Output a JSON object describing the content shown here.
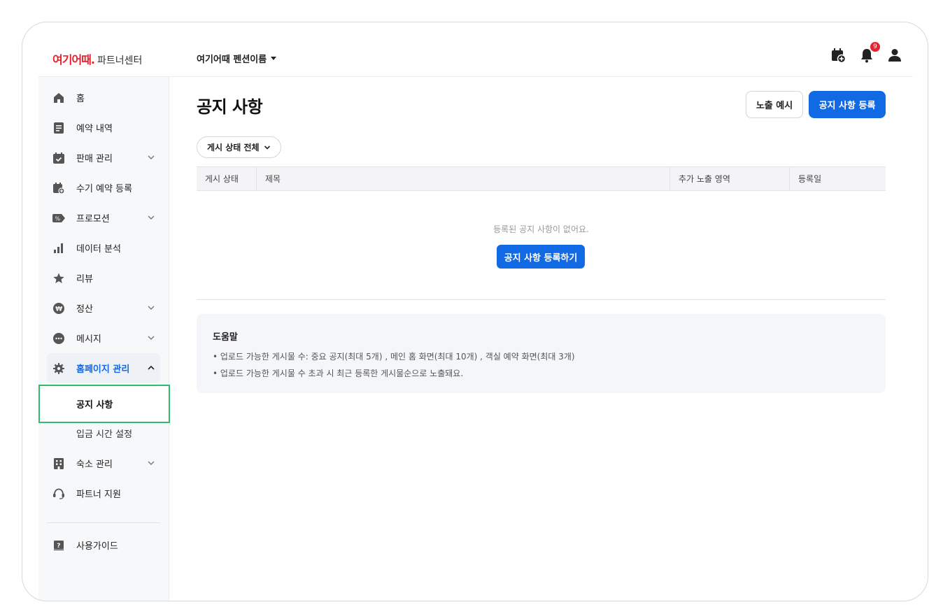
{
  "header": {
    "brand": "여기어때.",
    "brand_sub": "파트너센터",
    "property_name": "여기어때 펜션이름",
    "notification_count": "9"
  },
  "sidebar": {
    "items": [
      {
        "label": "홈",
        "icon": "home-icon"
      },
      {
        "label": "예약 내역",
        "icon": "document-icon"
      },
      {
        "label": "판매 관리",
        "icon": "calendar-check-icon"
      },
      {
        "label": "수기 예약 등록",
        "icon": "calendar-plus-icon"
      },
      {
        "label": "프로모션",
        "icon": "coupon-icon"
      },
      {
        "label": "데이터 분석",
        "icon": "bar-chart-icon"
      },
      {
        "label": "리뷰",
        "icon": "star-icon"
      },
      {
        "label": "정산",
        "icon": "won-coin-icon"
      },
      {
        "label": "메시지",
        "icon": "chat-icon"
      },
      {
        "label": "홈페이지 관리",
        "icon": "gear-icon"
      },
      {
        "label": "숙소 관리",
        "icon": "building-icon"
      },
      {
        "label": "파트너 지원",
        "icon": "headset-icon"
      }
    ],
    "sub_items": [
      "공지 사항",
      "입금 시간 설정"
    ],
    "guide": "사용가이드"
  },
  "main": {
    "title": "공지 사항",
    "preview_button": "노출 예시",
    "register_button": "공지 사항 등록",
    "filter_label": "게시 상태 전체",
    "columns": [
      "게시 상태",
      "제목",
      "추가 노출 영역",
      "등록일"
    ],
    "empty_message": "등록된 공지 사항이 없어요.",
    "empty_button": "공지 사항 등록하기",
    "help": {
      "title": "도움말",
      "lines": [
        "• 업로드 가능한 게시물 수: 중요 공지(최대 5개) , 메인 홈 화면(최대 10개) , 객실 예약 화면(최대 3개)",
        "• 업로드 가능한 게시물 수 초과 시 최근 등록한 게시물순으로 노출돼요."
      ]
    }
  },
  "colors": {
    "brand": "#e8212e",
    "primary": "#1269e4",
    "highlight": "#2ebd6b"
  }
}
